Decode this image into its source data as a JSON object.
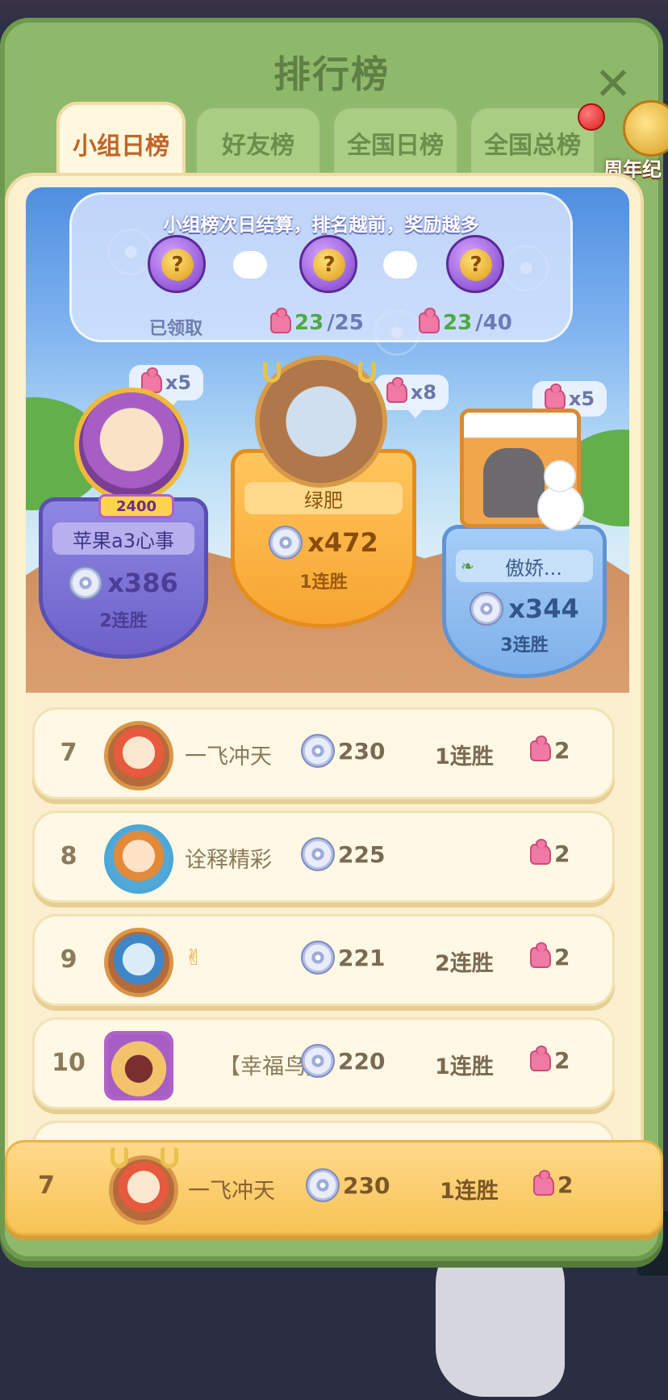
{
  "window": {
    "title": "排行榜"
  },
  "tabs": [
    {
      "label": "小组日榜",
      "active": true
    },
    {
      "label": "好友榜",
      "active": false
    },
    {
      "label": "全国日榜",
      "active": false
    },
    {
      "label": "全国总榜",
      "active": false
    }
  ],
  "side_badge": {
    "label": "周年纪"
  },
  "reward": {
    "title": "小组榜次日结算，排名越前，奖励越多",
    "chest1_caption": "已领取",
    "chest2_progress_num": "23",
    "chest2_progress_den": "/25",
    "chest3_progress_num": "23",
    "chest3_progress_den": "/40",
    "chest_glyph": "?"
  },
  "podium": {
    "left": {
      "name": "苹果a3心事",
      "score": "x386",
      "streak": "2连胜",
      "bonus": "x5",
      "badge": "2400"
    },
    "middle": {
      "name": "绿肥",
      "score": "x472",
      "streak": "1连胜",
      "bonus": "x8"
    },
    "right": {
      "name": "傲娇...",
      "score": "x344",
      "streak": "3连胜",
      "bonus": "x5"
    }
  },
  "rows": [
    {
      "rank": "7",
      "name": "一飞冲天",
      "points": "230",
      "streak": "1连胜",
      "pieces": "2"
    },
    {
      "rank": "8",
      "name": "诠释精彩",
      "points": "225",
      "streak": "",
      "pieces": "2"
    },
    {
      "rank": "9",
      "name": "✌",
      "points": "221",
      "streak": "2连胜",
      "pieces": "2"
    },
    {
      "rank": "10",
      "name": "【幸福鸟】",
      "points": "220",
      "streak": "1连胜",
      "pieces": "2"
    }
  ],
  "my_row": {
    "rank": "7",
    "name": "一飞冲天",
    "points": "230",
    "streak": "1连胜",
    "pieces": "2"
  },
  "colors": {
    "panel_green": "#8fb96a",
    "tab_active_text": "#c0652a",
    "gold_shield": "#f7a431",
    "purple_shield": "#6d61c9",
    "blue_shield": "#7eb0ea"
  }
}
